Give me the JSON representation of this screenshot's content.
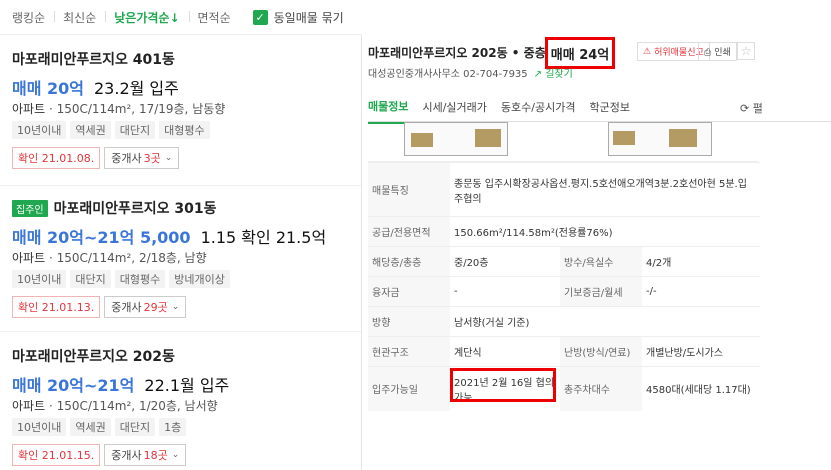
{
  "sort_bar": {
    "options": [
      "랭킹순",
      "최신순",
      "낮은가격순↓",
      "면적순"
    ],
    "active_index": 2,
    "group_same_label": "동일매물 묶기",
    "group_same_checked": true,
    "accent_color": "#1fa84f"
  },
  "listings": [
    {
      "name": "마포래미안푸르지오 401동",
      "owner_badge": "",
      "price": "매매 20억",
      "annotation": "23.2월 입주",
      "spec_type": "아파트",
      "spec_detail": "150C/114m², 17/19층, 남동향",
      "tags": [
        "10년이내",
        "역세권",
        "대단지",
        "대형평수"
      ],
      "confirm_date": "확인 21.01.08.",
      "agent_label": "중개사",
      "agent_count": "3곳"
    },
    {
      "name": "마포래미안푸르지오 301동",
      "owner_badge": "집주인",
      "price": "매매 20억~21억 5,000",
      "annotation": "1.15 확인 21.5억",
      "spec_type": "아파트",
      "spec_detail": "150C/114m², 2/18층, 남향",
      "tags": [
        "10년이내",
        "대단지",
        "대형평수",
        "방네개이상"
      ],
      "confirm_date": "확인 21.01.13.",
      "agent_label": "중개사",
      "agent_count": "29곳"
    },
    {
      "name": "마포래미안푸르지오 202동",
      "owner_badge": "",
      "price": "매매 20억~21억",
      "annotation": "22.1월 입주",
      "spec_type": "아파트",
      "spec_detail": "150C/114m², 1/20층, 남서향",
      "tags": [
        "10년이내",
        "역세권",
        "대단지",
        "1층"
      ],
      "confirm_date": "확인 21.01.15.",
      "agent_label": "중개사",
      "agent_count": "18곳"
    }
  ],
  "detail": {
    "title": "마포래미안푸르지오 202동 • 중층",
    "price": "매매 24억",
    "report_label": "허위매물신고",
    "print_label": "인쇄",
    "agency": "대성공인중개사사무소 02-704-7935",
    "route_label": "길찾기",
    "tabs": [
      "매물정보",
      "시세/실거래가",
      "동호수/공시가격",
      "학군정보"
    ],
    "active_tab": 0,
    "refresh_label": "⟳ 펼",
    "rows": [
      {
        "k1": "매물특징",
        "v1": "종문동 입주시확장공사옵션.평지.5호선애오개역3분.2호선아현 5분.입주협의",
        "k2": "",
        "v2": ""
      },
      {
        "k1": "공급/전용면적",
        "v1": "150.66m²/114.58m²(전용률76%)",
        "k2": "",
        "v2": ""
      },
      {
        "k1": "해당층/총층",
        "v1": "중/20층",
        "k2": "방수/욕실수",
        "v2": "4/2개"
      },
      {
        "k1": "융자금",
        "v1": "-",
        "k2": "기보증금/월세",
        "v2": "-/-"
      },
      {
        "k1": "방향",
        "v1": "남서향(거실 기준)",
        "k2": "",
        "v2": ""
      },
      {
        "k1": "현관구조",
        "v1": "계단식",
        "k2": "난방(방식/연료)",
        "v2": "개별난방/도시가스"
      },
      {
        "k1": "입주가능일",
        "v1": "2021년 2월 16일 협의가능",
        "k2": "총주차대수",
        "v2": "4580대(세대당 1.17대)"
      }
    ]
  }
}
